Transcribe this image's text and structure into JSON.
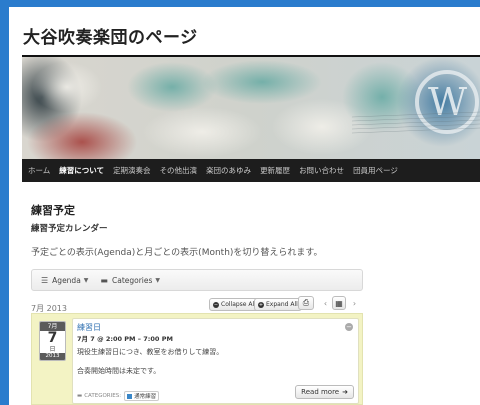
{
  "site": {
    "title": "大谷吹奏楽団のページ"
  },
  "nav": {
    "items": [
      {
        "label": "ホーム",
        "active": false
      },
      {
        "label": "練習について",
        "active": true
      },
      {
        "label": "定期演奏会",
        "active": false
      },
      {
        "label": "その他出演",
        "active": false
      },
      {
        "label": "楽団のあゆみ",
        "active": false
      },
      {
        "label": "更新履歴",
        "active": false
      },
      {
        "label": "お問い合わせ",
        "active": false
      },
      {
        "label": "団員用ページ",
        "active": false
      }
    ]
  },
  "content": {
    "title": "練習予定",
    "calendar_heading": "練習予定カレンダー",
    "description": "予定ごとの表示(Agenda)と月ごとの表示(Month)を切り替えられます。"
  },
  "toolbar": {
    "agenda_label": "Agenda",
    "categories_label": "Categories"
  },
  "calendar": {
    "month_label": "7月 2013",
    "collapse_all": "Collapse All",
    "expand_all": "Expand All"
  },
  "event": {
    "badge_month": "7月",
    "badge_day": "7",
    "badge_weekday": "日",
    "badge_year": "2013",
    "title": "練習日",
    "time": "7月 7 @ 2:00 PM – 7:00 PM",
    "desc_line1": "現役生練習日につき、教室をお借りして練習。",
    "desc_line2": "合奏開始時間は未定です。",
    "categories_label": "CATEGORIES:",
    "category": "通常練習",
    "category_color": "#3a87c8",
    "read_more": "Read more"
  },
  "colors": {
    "frame": "#2a7ccd",
    "nav_bg": "#1d1d1d",
    "event_bg": "#f3f3c4"
  }
}
